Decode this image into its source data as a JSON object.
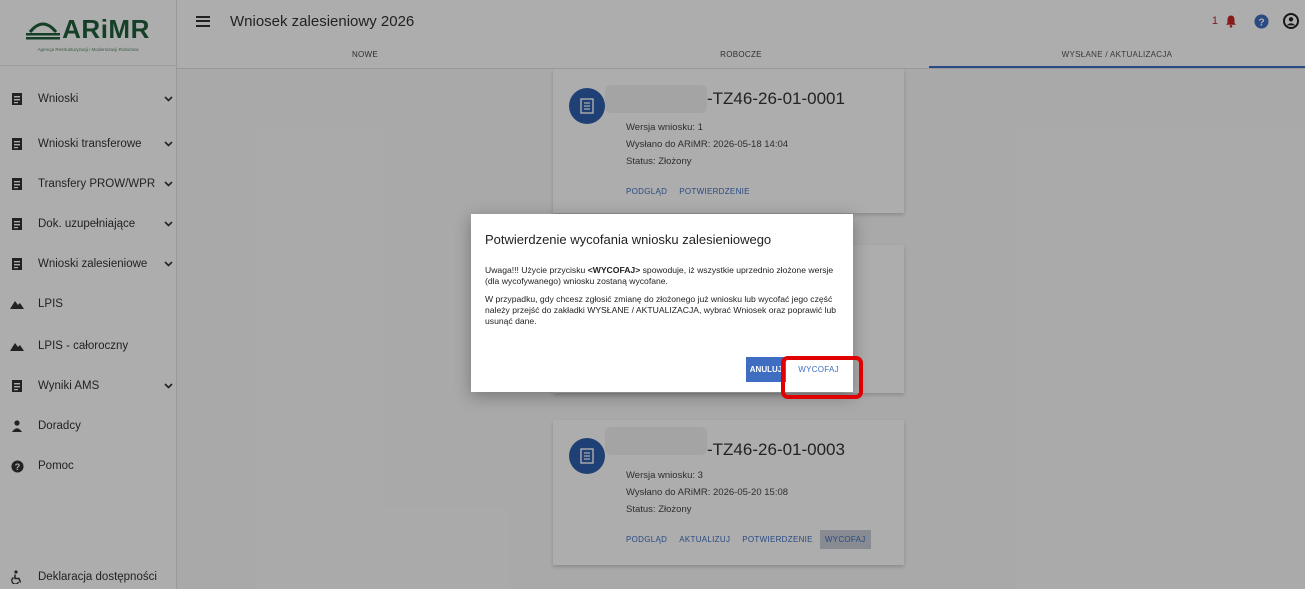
{
  "brand": {
    "name": "ARiMR",
    "subtitle": "Agencja Restrukturyzacji i Modernizacji Rolnictwa"
  },
  "header": {
    "title": "Wniosek zalesieniowy 2026",
    "notification_count": "1"
  },
  "tabs": [
    {
      "label": "NOWE",
      "active": false
    },
    {
      "label": "ROBOCZE",
      "active": false
    },
    {
      "label": "WYSŁANE / AKTUALIZACJA",
      "active": true
    }
  ],
  "sidebar": {
    "items": [
      {
        "label": "Wnioski",
        "icon": "document-icon",
        "expandable": true
      },
      {
        "label": "Wnioski transferowe",
        "icon": "document-icon",
        "expandable": true
      },
      {
        "label": "Transfery PROW/WPR",
        "icon": "document-icon",
        "expandable": true
      },
      {
        "label": "Dok. uzupełniające",
        "icon": "document-icon",
        "expandable": true
      },
      {
        "label": "Wnioski zalesieniowe",
        "icon": "document-icon",
        "expandable": true
      },
      {
        "label": "LPIS",
        "icon": "mountain-icon",
        "expandable": false
      },
      {
        "label": "LPIS - całoroczny",
        "icon": "mountain-icon",
        "expandable": false
      },
      {
        "label": "Wyniki AMS",
        "icon": "document-icon",
        "expandable": true
      },
      {
        "label": "Doradcy",
        "icon": "person-icon",
        "expandable": false
      },
      {
        "label": "Pomoc",
        "icon": "help-icon",
        "expandable": false
      }
    ],
    "footer": {
      "label": "Deklaracja dostępności",
      "icon": "accessibility-icon"
    }
  },
  "cards": [
    {
      "number": "-TZ46-26-01-0001",
      "version": "Wersja wniosku: 1",
      "sent": "Wysłano do ARiMR: 2026-05-18 14:04",
      "status": "Status: Złożony",
      "actions": [
        "PODGLĄD",
        "POTWIERDZENIE"
      ]
    },
    {
      "number": "-TZ46-26-01-0003",
      "version": "Wersja wniosku: 3",
      "sent": "Wysłano do ARiMR: 2026-05-20 15:08",
      "status": "Status: Złożony",
      "actions": [
        "PODGLĄD",
        "AKTUALIZUJ",
        "POTWIERDZENIE",
        "WYCOFAJ"
      ]
    }
  ],
  "dialog": {
    "title": "Potwierdzenie wycofania wniosku zalesieniowego",
    "p1_before": "Uwaga!!! Użycie przycisku ",
    "p1_bold": "<WYCOFAJ>",
    "p1_after": " spowoduje, iż wszystkie uprzednio złożone wersje (dla wycofywanego) wniosku zostaną wycofane.",
    "p2": "W przypadku, gdy chcesz zgłosić zmianę do złożonego już wniosku lub wycofać jego część należy przejść do zakładki WYSŁANE / AKTUALIZACJA, wybrać Wniosek oraz poprawić lub usunąć dane.",
    "cancel_label": "ANULUJ",
    "confirm_label": "WYCOFAJ"
  },
  "colors": {
    "primary": "#3e6dc2",
    "brand_green": "#1f5f3a",
    "highlight_red": "#e00000",
    "notification_red": "#c62828"
  }
}
